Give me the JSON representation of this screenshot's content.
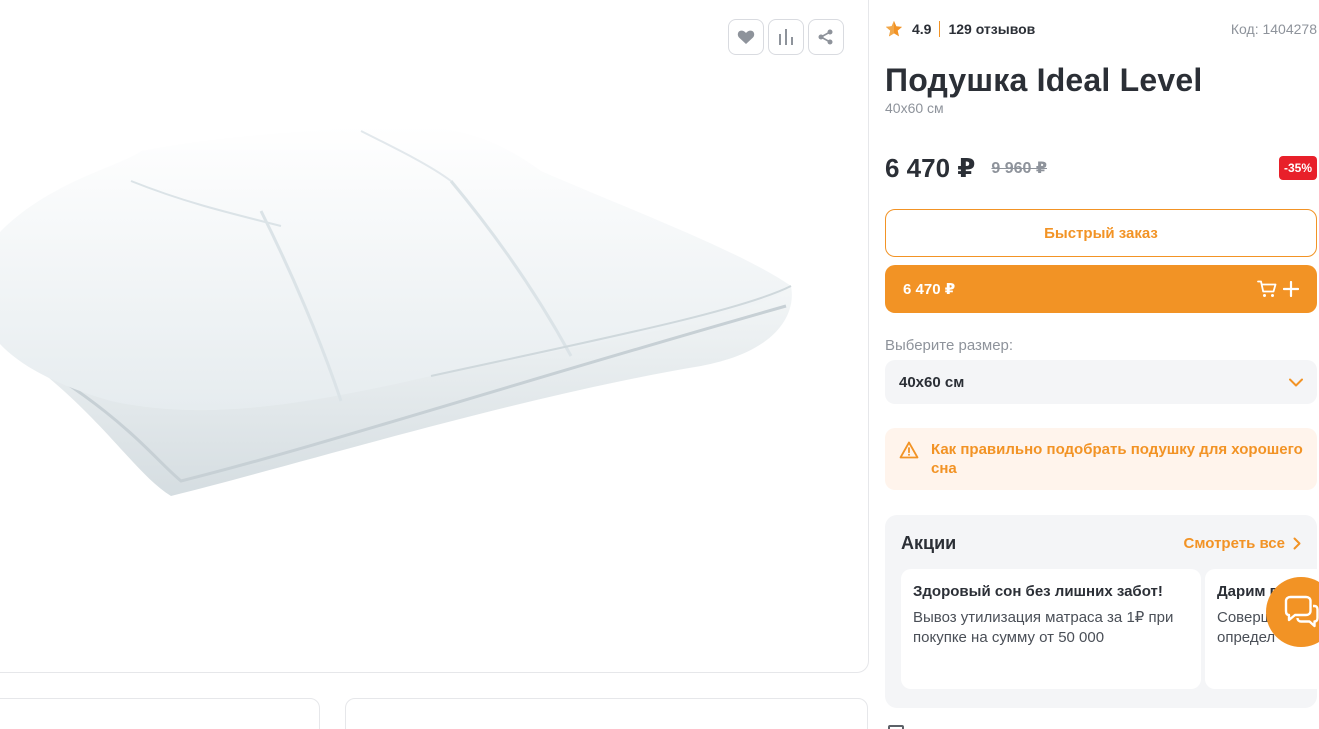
{
  "gallery": {
    "actions": [
      {
        "icon": "heart-icon"
      },
      {
        "icon": "compare-icon"
      },
      {
        "icon": "share-icon"
      }
    ]
  },
  "product": {
    "rating": "4.9",
    "reviews": "129 отзывов",
    "code_label": "Код: 1404278",
    "title": "Подушка Ideal Level",
    "subtitle": "40x60 см",
    "price": "6 470 ₽",
    "old_price": "9 960 ₽",
    "discount": "-35%"
  },
  "buttons": {
    "quick_order": "Быстрый заказ",
    "cart_price": "6 470 ₽"
  },
  "size": {
    "label": "Выберите размер:",
    "selected": "40x60 см"
  },
  "tip": {
    "text": "Как правильно подобрать подушку для хорошего сна"
  },
  "promos": {
    "title": "Акции",
    "see_all": "Смотреть все",
    "cards": [
      {
        "title": "Здоровый сон без лишних забот!",
        "desc": "Вывоз утилизация матраса за 1₽ при покупке на сумму от 50 000"
      },
      {
        "title": "Дарим п",
        "desc": "Соверш определ"
      }
    ]
  },
  "colors": {
    "accent": "#f29325",
    "discount": "#e8202a",
    "text": "#2b2f36",
    "muted": "#8e939b"
  }
}
